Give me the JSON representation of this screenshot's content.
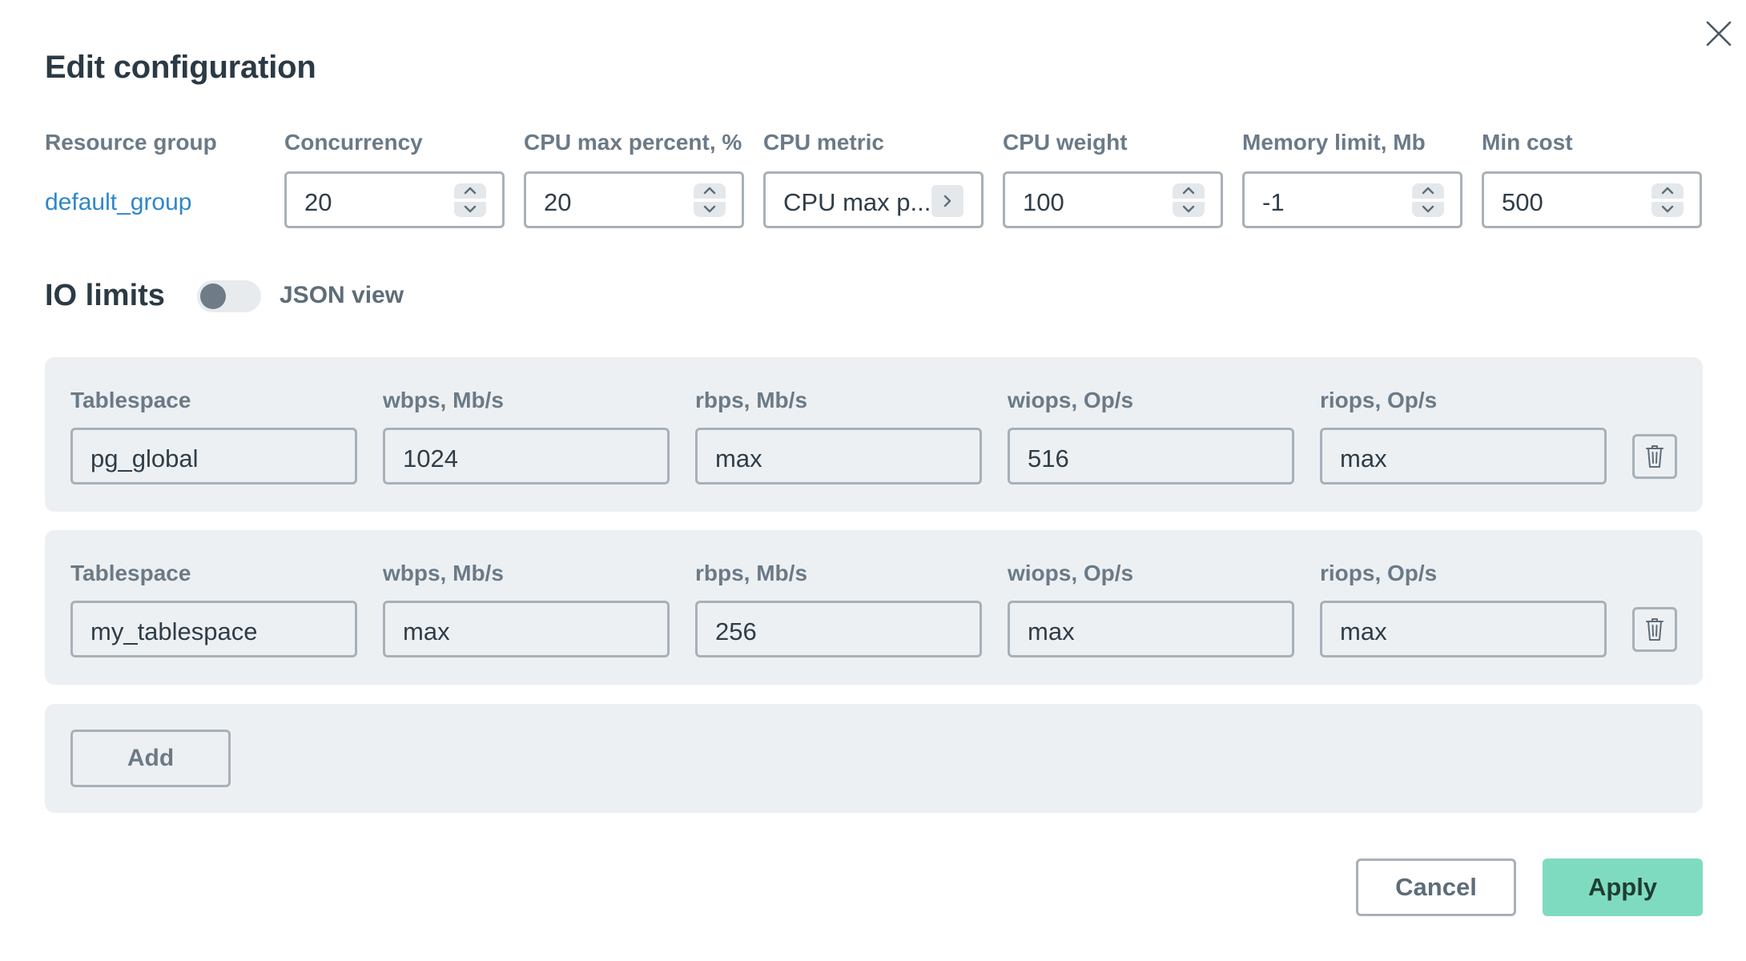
{
  "dialog": {
    "title": "Edit configuration",
    "close_icon": "close-icon"
  },
  "config": {
    "labels": {
      "resource_group": "Resource group",
      "concurrency": "Concurrency",
      "cpu_max_percent": "CPU max percent, %",
      "cpu_metric": "CPU metric",
      "cpu_weight": "CPU weight",
      "memory_limit": "Memory limit, Mb",
      "min_cost": "Min cost"
    },
    "resource_group": "default_group",
    "concurrency": "20",
    "cpu_max_percent": "20",
    "cpu_metric": "CPU max p...",
    "cpu_weight": "100",
    "memory_limit": "-1",
    "min_cost": "500"
  },
  "io_limits": {
    "title": "IO limits",
    "json_view_label": "JSON view",
    "json_view_enabled": false,
    "column_labels": {
      "tablespace": "Tablespace",
      "wbps": "wbps, Mb/s",
      "rbps": "rbps, Mb/s",
      "wiops": "wiops, Op/s",
      "riops": "riops, Op/s"
    },
    "rows": [
      {
        "tablespace": "pg_global",
        "wbps": "1024",
        "rbps": "max",
        "wiops": "516",
        "riops": "max"
      },
      {
        "tablespace": "my_tablespace",
        "wbps": "max",
        "rbps": "256",
        "wiops": "max",
        "riops": "max"
      }
    ],
    "add_label": "Add"
  },
  "footer": {
    "cancel_label": "Cancel",
    "apply_label": "Apply"
  },
  "colors": {
    "link": "#2f87c8",
    "apply_bg": "#7fdbbf",
    "panel_bg": "#edf0f3",
    "border": "#a7b1b9"
  }
}
